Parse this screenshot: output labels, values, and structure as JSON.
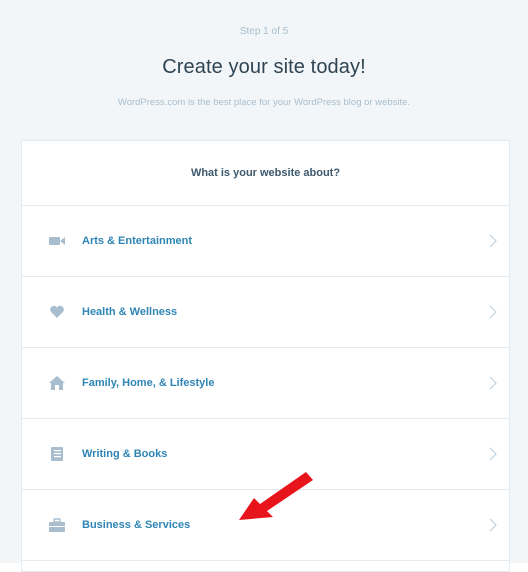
{
  "header": {
    "step": "Step 1 of 5",
    "title": "Create your site today!",
    "subtitle": "WordPress.com is the best place for your WordPress blog or website."
  },
  "card": {
    "question": "What is your website about?",
    "items": [
      {
        "label": "Arts & Entertainment",
        "icon": "video-camera-icon"
      },
      {
        "label": "Health & Wellness",
        "icon": "heart-icon"
      },
      {
        "label": "Family, Home, & Lifestyle",
        "icon": "home-icon"
      },
      {
        "label": "Writing & Books",
        "icon": "book-icon"
      },
      {
        "label": "Business & Services",
        "icon": "briefcase-icon"
      }
    ]
  },
  "colors": {
    "label": "#2f85b5",
    "icon": "#a8bece",
    "arrow": "#e8141b"
  }
}
